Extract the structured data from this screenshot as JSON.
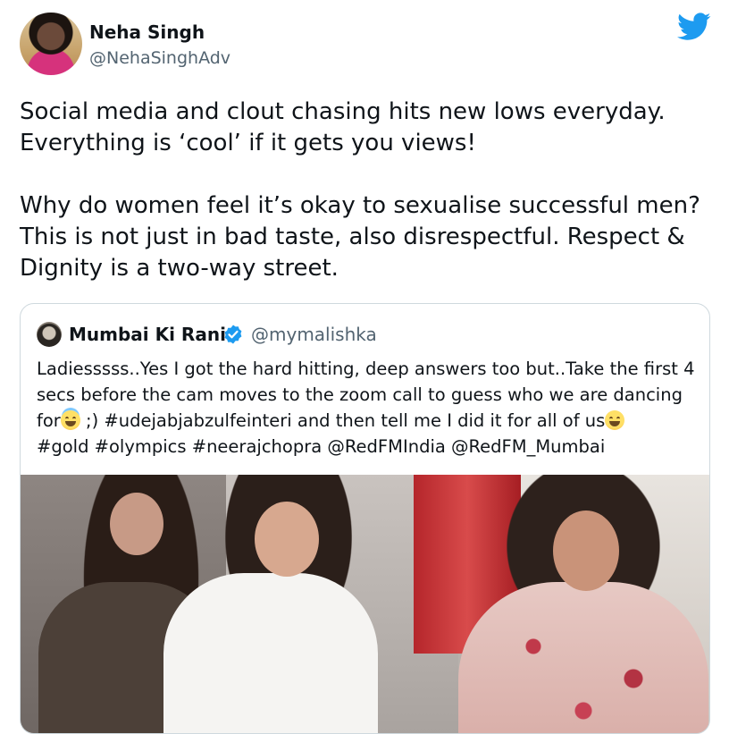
{
  "author": {
    "name": "Neha Singh",
    "handle": "@NehaSinghAdv"
  },
  "brand": {
    "icon": "twitter-bird-icon",
    "color": "#1d9bf0"
  },
  "tweet": {
    "lines": [
      "Social media and clout chasing hits new lows everyday.",
      "Everything is ‘cool’ if it gets you views!",
      "Why do women feel it’s okay to sexualise successful men?",
      "This is not just in bad taste, also disrespectful. Respect &",
      "Dignity is a two-way street."
    ]
  },
  "quoted": {
    "name": "Mumbai Ki Rani",
    "handle": "@mymalishka",
    "verified_icon": "verified-badge-icon",
    "line1": "Ladiesssss..Yes I got the hard hitting, deep answers too but..Take the first 4",
    "line2": "secs before the cam moves to the zoom call to guess who we are dancing",
    "line3_a": "for",
    "line3_b": " ;) #udejabjabzulfeinteri and then tell me I did it for all of us",
    "line4": "#gold #olympics #neerajchopra @RedFMIndia @RedFM_Mumbai",
    "emoji_1": "smiling-face-with-halo-icon",
    "emoji_2": "grinning-squinting-face-icon"
  },
  "colors": {
    "text": "#0f1419",
    "secondary": "#536471",
    "border": "#cfd9de"
  }
}
